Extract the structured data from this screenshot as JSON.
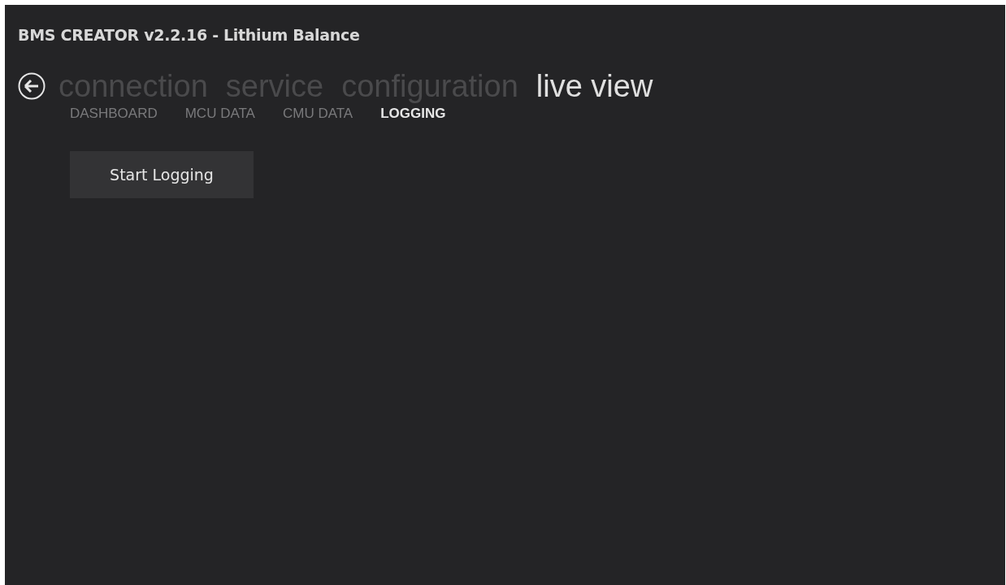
{
  "window": {
    "title": "BMS CREATOR v2.2.16 - Lithium Balance"
  },
  "nav": [
    {
      "label": "connection",
      "selected": false
    },
    {
      "label": "service",
      "selected": false
    },
    {
      "label": "configuration",
      "selected": false
    },
    {
      "label": "live view",
      "selected": true
    }
  ],
  "tabs": [
    {
      "label": "DASHBOARD",
      "selected": false
    },
    {
      "label": "MCU DATA",
      "selected": false
    },
    {
      "label": "CMU DATA",
      "selected": false
    },
    {
      "label": "LOGGING",
      "selected": true
    }
  ],
  "buttons": [
    "Start Logging"
  ]
}
